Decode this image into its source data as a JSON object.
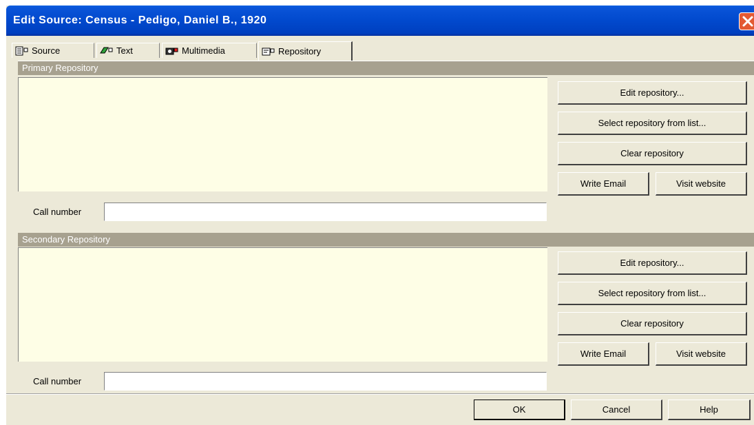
{
  "window": {
    "title": "Edit Source: Census - Pedigo, Daniel B., 1920"
  },
  "tabs": [
    {
      "label": "Source",
      "icon": "source-icon"
    },
    {
      "label": "Text",
      "icon": "text-icon"
    },
    {
      "label": "Multimedia",
      "icon": "camera-icon"
    },
    {
      "label": "Repository",
      "icon": "repository-icon",
      "active": true
    }
  ],
  "primary": {
    "header": "Primary Repository",
    "edit_label": "Edit repository...",
    "select_label": "Select repository from list...",
    "clear_label": "Clear repository",
    "email_label": "Write Email",
    "website_label": "Visit website",
    "call_number_label": "Call number",
    "call_number_value": ""
  },
  "secondary": {
    "header": "Secondary Repository",
    "edit_label": "Edit repository...",
    "select_label": "Select repository from list...",
    "clear_label": "Clear repository",
    "email_label": "Write Email",
    "website_label": "Visit website",
    "call_number_label": "Call number",
    "call_number_value": ""
  },
  "footer": {
    "ok_label": "OK",
    "cancel_label": "Cancel",
    "help_label": "Help"
  },
  "colors": {
    "titlebar": "#0149cd",
    "repo_box": "#fefee6",
    "section_header": "#a7a18f",
    "dialog_bg": "#ece9d8"
  }
}
